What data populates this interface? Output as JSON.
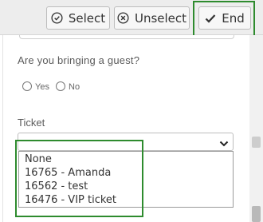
{
  "toolbar": {
    "select_label": "Select",
    "unselect_label": "Unselect",
    "end_label": "End"
  },
  "form": {
    "guest_question": "Are you bringing a guest?",
    "guest_options": [
      "Yes",
      "No"
    ],
    "ticket_label": "Ticket",
    "ticket_options": [
      "None",
      "16765 - Amanda",
      "16562 - test",
      "16476 - VIP ticket"
    ]
  },
  "colors": {
    "highlight": "#2e8b2e",
    "toolbar_bg": "#ededed"
  }
}
